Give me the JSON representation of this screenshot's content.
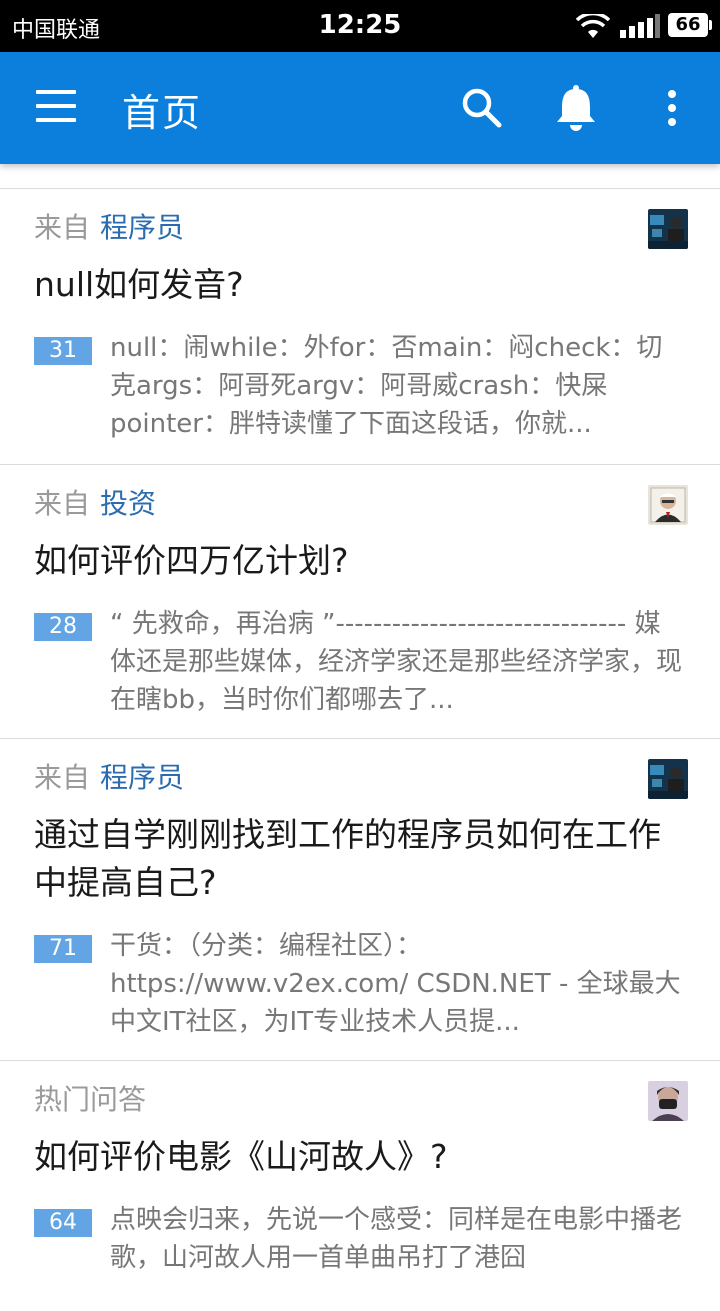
{
  "status_bar": {
    "carrier": "中国联通",
    "time": "12:25",
    "battery": "66"
  },
  "app_bar": {
    "title": "首页",
    "accent_color": "#0b7fdb"
  },
  "feed": [
    {
      "source_prefix": "来自",
      "topic": "程序员",
      "title": "null如何发音?",
      "votes": "31",
      "excerpt": "null：闹while：外for：否main：闷check：切克args：阿哥死argv：阿哥威crash：快屎pointer：胖特读懂了下面这段话，你就...",
      "avatar": "programmer-avatar"
    },
    {
      "source_prefix": "来自",
      "topic": "投资",
      "title": "如何评价四万亿计划?",
      "votes": "28",
      "excerpt": "“ 先救命，再治病 ”------------------------------- 媒体还是那些媒体，经济学家还是那些经济学家，现在瞎bb，当时你们都哪去了...",
      "avatar": "portrait-avatar"
    },
    {
      "source_prefix": "来自",
      "topic": "程序员",
      "title": "通过自学刚刚找到工作的程序员如何在工作中提高自己?",
      "votes": "71",
      "excerpt": "干货：（分类：编程社区）：https://www.v2ex.com/ CSDN.NET - 全球最大中文IT社区，为IT专业技术人员提...",
      "avatar": "programmer-avatar"
    },
    {
      "source_prefix": "热门问答",
      "topic": "",
      "title": "如何评价电影《山河故人》?",
      "votes": "64",
      "excerpt": "点映会归来，先说一个感受：同样是在电影中播老歌，山河故人用一首单曲吊打了港囧",
      "avatar": "masked-person-avatar"
    }
  ]
}
